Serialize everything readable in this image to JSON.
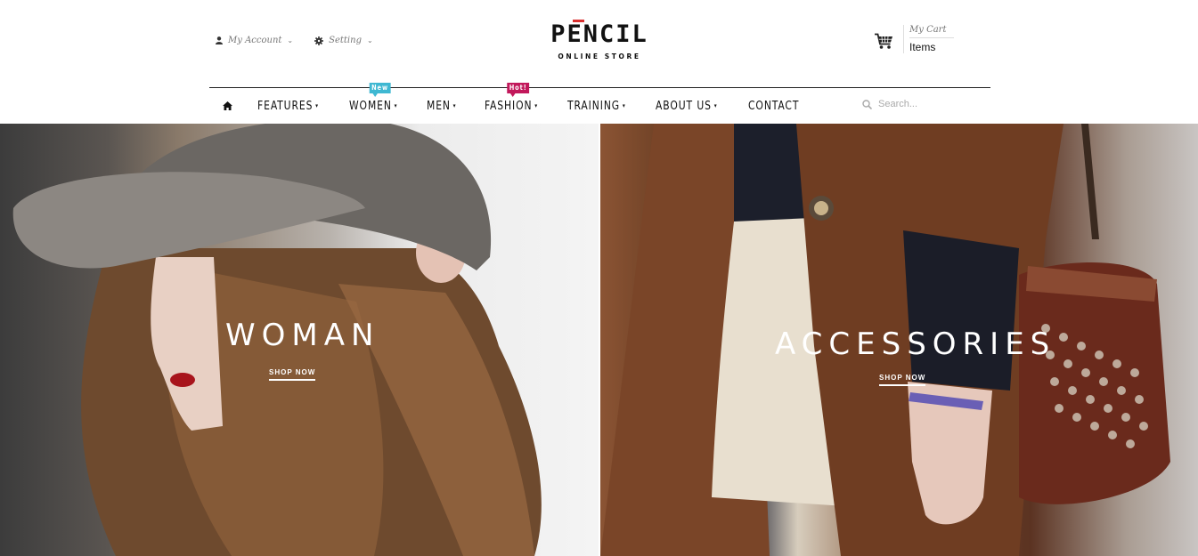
{
  "top_links": {
    "account": "My Account",
    "setting": "Setting"
  },
  "logo": {
    "name": "PENCIL",
    "tagline": "ONLINE STORE"
  },
  "cart": {
    "title": "My Cart",
    "items": "Items"
  },
  "nav": {
    "items": [
      {
        "label": "FEATURES",
        "has_dropdown": true
      },
      {
        "label": "WOMEN",
        "has_dropdown": true,
        "badge": "New"
      },
      {
        "label": "MEN",
        "has_dropdown": true
      },
      {
        "label": "FASHION",
        "has_dropdown": true,
        "badge": "Hot!"
      },
      {
        "label": "TRAINING",
        "has_dropdown": true
      },
      {
        "label": "ABOUT US",
        "has_dropdown": true
      },
      {
        "label": "CONTACT",
        "has_dropdown": false
      }
    ],
    "dropdown_symbol": "▾",
    "search_placeholder": "Search..."
  },
  "banners": {
    "left": {
      "title": "WOMAN",
      "link": "SHOP NOW"
    },
    "right": {
      "title": "ACCESSORIES",
      "link": "SHOP NOW"
    }
  },
  "colors": {
    "logo_accent": "#d9302f",
    "badge_new": "#3fb8d2",
    "badge_hot": "#c2185b"
  },
  "icons": {
    "home": "home-icon",
    "account": "user-icon",
    "setting": "gear-icon",
    "cart": "cart-icon",
    "search": "search-icon",
    "side_toggle": "sliders-icon"
  }
}
